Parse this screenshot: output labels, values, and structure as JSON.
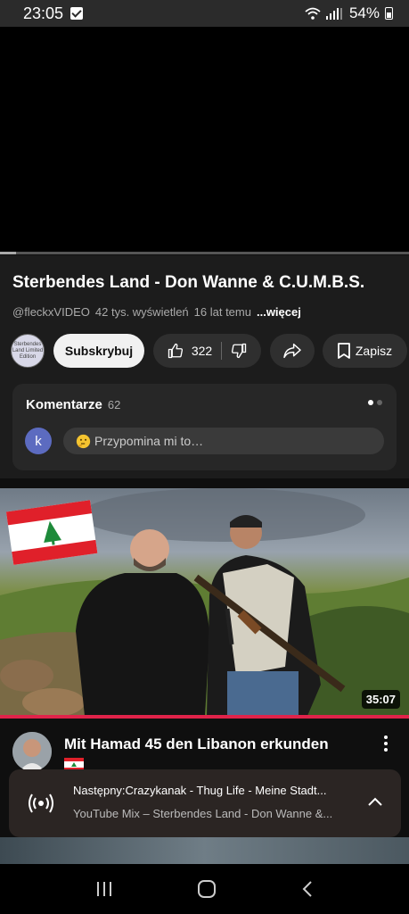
{
  "status_bar": {
    "time": "23:05",
    "battery": "54%",
    "icons": [
      "check-icon",
      "wifi-icon",
      "signal-icon",
      "battery-icon"
    ]
  },
  "player": {
    "progress_percent": 4
  },
  "video": {
    "title": "Sterbendes Land - Don Wanne & C.U.M.B.S.",
    "channel": "@fleckxVIDEO",
    "views": "42 tys. wyświetleń",
    "age": "16 lat temu",
    "more": "...więcej",
    "channel_avatar_text": "Sterbendes Land Limited Edition"
  },
  "actions": {
    "subscribe": "Subskrybuj",
    "likes": "322",
    "save": "Zapisz"
  },
  "comments": {
    "label": "Komentarze",
    "count": "62",
    "user_initial": "k",
    "placeholder": "Przypomina mi to…"
  },
  "next_video": {
    "duration": "35:07",
    "title": "Mit Hamad 45 den Libanon erkunden"
  },
  "mini_player": {
    "next_label": "Następny:",
    "next_title": "Crazykanak - Thug Life - Meine Stadt...",
    "mix_title": "YouTube Mix – Sterbendes Land - Don Wanne &..."
  },
  "colors": {
    "background": "#0f0f0f",
    "accent_red": "#e0234a",
    "subscribe_bg": "#f1f1f1"
  }
}
